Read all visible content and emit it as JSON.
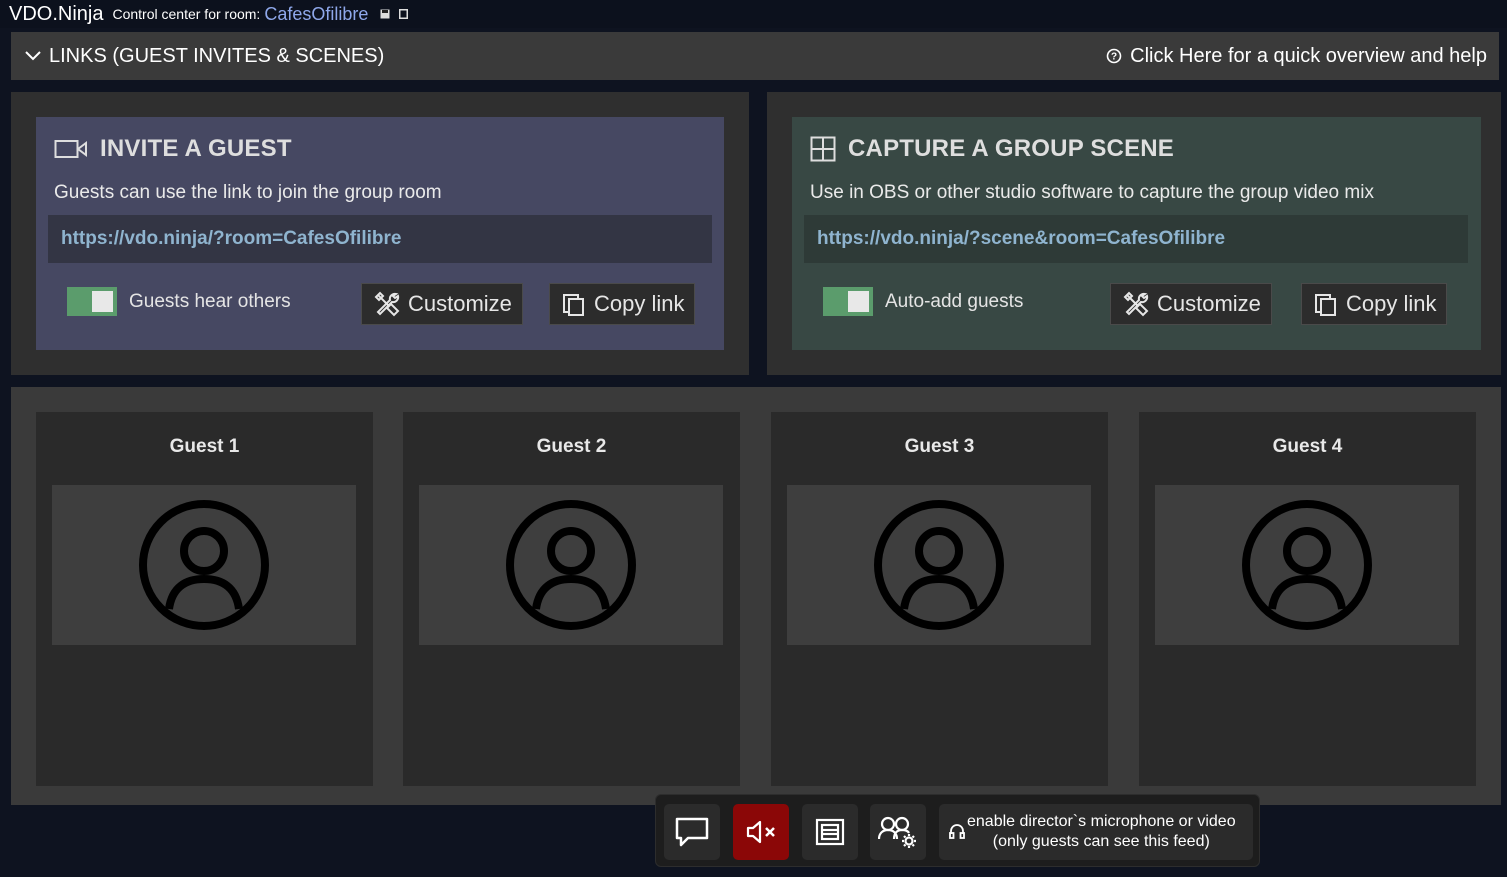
{
  "header": {
    "brand": "VDO.Ninja",
    "control_label": "Control center for room:",
    "room_name": "CafesOfilibre"
  },
  "links_bar": {
    "toggle_label": "LINKS (GUEST INVITES & SCENES)",
    "help_label": "Click Here for a quick overview and help"
  },
  "invite": {
    "title": "INVITE A GUEST",
    "description": "Guests can use the link to join the group room",
    "link": "https://vdo.ninja/?room=CafesOfilibre",
    "toggle_label": "Guests hear others",
    "toggle_on": true,
    "customize_label": "Customize",
    "copy_label": "Copy link",
    "accent_color": "#464862"
  },
  "scene": {
    "title": "CAPTURE A GROUP SCENE",
    "description": "Use in OBS or other studio software to capture the group video mix",
    "link": "https://vdo.ninja/?scene&room=CafesOfilibre",
    "toggle_label": "Auto-add guests",
    "toggle_on": true,
    "customize_label": "Customize",
    "copy_label": "Copy link",
    "accent_color": "#384844"
  },
  "guests": [
    {
      "name": "Guest 1",
      "icon": "user-avatar-icon"
    },
    {
      "name": "Guest 2",
      "icon": "user-avatar-icon"
    },
    {
      "name": "Guest 3",
      "icon": "user-avatar-icon"
    },
    {
      "name": "Guest 4",
      "icon": "user-avatar-icon"
    }
  ],
  "control_bar": {
    "buttons": [
      {
        "name": "chat",
        "icon": "chat-icon"
      },
      {
        "name": "mute-speaker",
        "icon": "speaker-muted-icon",
        "color": "#8b0707"
      },
      {
        "name": "layout",
        "icon": "layout-icon"
      },
      {
        "name": "guest-settings",
        "icon": "users-settings-icon"
      }
    ],
    "director_line1": "enable director`s microphone or video",
    "director_line2": "(only guests can see this feed)"
  }
}
